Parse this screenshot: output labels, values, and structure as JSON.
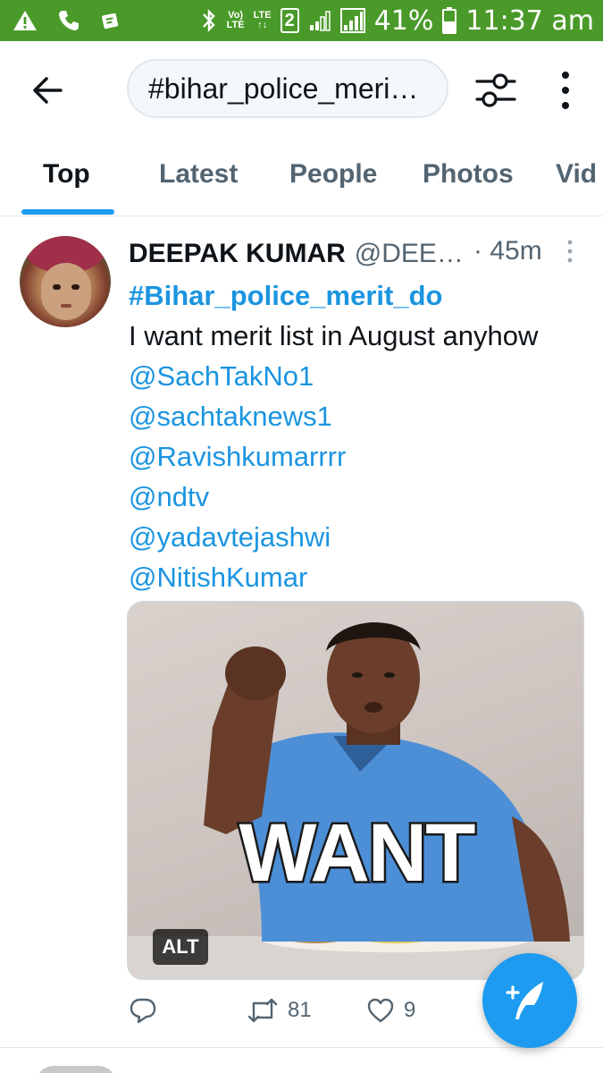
{
  "status_bar": {
    "network_small": [
      "Vo)",
      "LTE"
    ],
    "lte2": [
      "LTE",
      "↑↓"
    ],
    "sim_slot": "2",
    "battery": "41%",
    "time": "11:37 am"
  },
  "header": {
    "search_value": "#bihar_police_meri…"
  },
  "tabs": [
    {
      "label": "Top"
    },
    {
      "label": "Latest"
    },
    {
      "label": "People"
    },
    {
      "label": "Photos"
    },
    {
      "label": "Vid"
    }
  ],
  "tweet": {
    "display_name": "DEEPAK KUMAR",
    "handle": "@DEE…",
    "time": "· 45m",
    "hashtag": "#Bihar_police_merit_do",
    "text": "I want merit list in August anyhow",
    "mentions": [
      "@SachTakNo1",
      "@sachtaknews1",
      "@Ravishkumarrrr",
      "@ndtv",
      "@yadavtejashwi",
      "@NitishKumar"
    ],
    "media": {
      "overlay_text": "WANT",
      "alt_badge": "ALT"
    },
    "retweet_count": "81",
    "like_count": "9"
  },
  "colors": {
    "status_bar": "#4a9a2a",
    "accent": "#1d9bf0",
    "link": "#1b95e0",
    "muted": "#536471"
  }
}
